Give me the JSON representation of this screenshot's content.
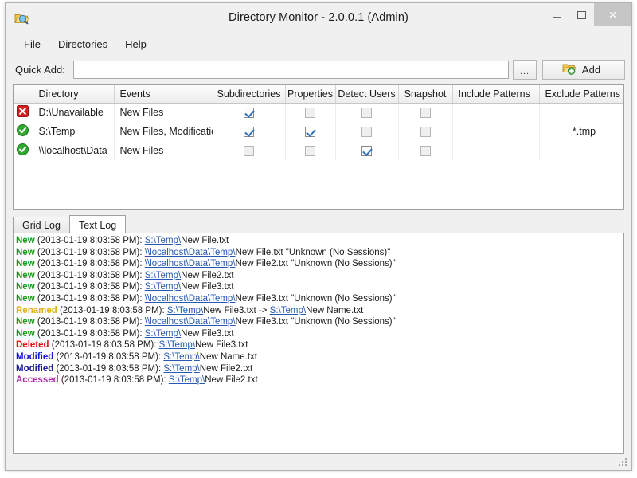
{
  "window": {
    "title": "Directory Monitor - 2.0.0.1 (Admin)",
    "app_icon": "folder-magnifier-icon",
    "minimize_label": "–",
    "maximize_label": "❐",
    "close_label": "×"
  },
  "menu": {
    "items": [
      {
        "label": "File"
      },
      {
        "label": "Directories"
      },
      {
        "label": "Help"
      }
    ]
  },
  "quick_add": {
    "label": "Quick Add:",
    "value": "",
    "placeholder": "",
    "browse_label": "...",
    "add_label": "Add",
    "add_icon": "folder-add-icon"
  },
  "grid": {
    "columns": [
      {
        "key": "status",
        "label": ""
      },
      {
        "key": "directory",
        "label": "Directory"
      },
      {
        "key": "events",
        "label": "Events"
      },
      {
        "key": "subdirectories",
        "label": "Subdirectories"
      },
      {
        "key": "properties",
        "label": "Properties"
      },
      {
        "key": "detect_users",
        "label": "Detect Users"
      },
      {
        "key": "snapshot",
        "label": "Snapshot"
      },
      {
        "key": "include_patterns",
        "label": "Include Patterns"
      },
      {
        "key": "exclude_patterns",
        "label": "Exclude Patterns"
      }
    ],
    "rows": [
      {
        "status": "error-icon",
        "directory": "D:\\Unavailable",
        "events": "New Files",
        "subdirectories": true,
        "properties": false,
        "detect_users": false,
        "snapshot": false,
        "include_patterns": "",
        "exclude_patterns": ""
      },
      {
        "status": "ok-icon",
        "directory": "S:\\Temp",
        "events": "New Files, Modificatio...",
        "subdirectories": true,
        "properties": true,
        "detect_users": false,
        "snapshot": false,
        "include_patterns": "",
        "exclude_patterns": "*.tmp"
      },
      {
        "status": "ok-icon",
        "directory": "\\\\localhost\\Data",
        "events": "New Files",
        "subdirectories": false,
        "properties": false,
        "detect_users": true,
        "snapshot": false,
        "include_patterns": "",
        "exclude_patterns": ""
      }
    ]
  },
  "tabs": [
    {
      "label": "Grid Log",
      "active": false
    },
    {
      "label": "Text Log",
      "active": true
    }
  ],
  "colors": {
    "new": "#1a9a1a",
    "renamed": "#e0b016",
    "deleted": "#e01010",
    "modified": "#1616d8",
    "modified_alt": "#1b1b9a",
    "accessed": "#b028a8",
    "link": "#2759b0"
  },
  "log": {
    "lines": [
      {
        "event": "New",
        "color": "new",
        "timestamp": "(2013-01-19 8:03:58 PM): ",
        "parts": [
          {
            "t": "link",
            "v": "S:\\Temp\\"
          },
          {
            "t": "text",
            "v": "New File.txt"
          }
        ]
      },
      {
        "event": "New",
        "color": "new",
        "timestamp": "(2013-01-19 8:03:58 PM): ",
        "parts": [
          {
            "t": "link",
            "v": "\\\\localhost\\Data\\Temp\\"
          },
          {
            "t": "text",
            "v": "New File.txt \"Unknown (No Sessions)\""
          }
        ]
      },
      {
        "event": "New",
        "color": "new",
        "timestamp": "(2013-01-19 8:03:58 PM): ",
        "parts": [
          {
            "t": "link",
            "v": "\\\\localhost\\Data\\Temp\\"
          },
          {
            "t": "text",
            "v": "New File2.txt \"Unknown (No Sessions)\""
          }
        ]
      },
      {
        "event": "New",
        "color": "new",
        "timestamp": "(2013-01-19 8:03:58 PM): ",
        "parts": [
          {
            "t": "link",
            "v": "S:\\Temp\\"
          },
          {
            "t": "text",
            "v": "New File2.txt"
          }
        ]
      },
      {
        "event": "New",
        "color": "new",
        "timestamp": "(2013-01-19 8:03:58 PM): ",
        "parts": [
          {
            "t": "link",
            "v": "S:\\Temp\\"
          },
          {
            "t": "text",
            "v": "New File3.txt"
          }
        ]
      },
      {
        "event": "New",
        "color": "new",
        "timestamp": "(2013-01-19 8:03:58 PM): ",
        "parts": [
          {
            "t": "link",
            "v": "\\\\localhost\\Data\\Temp\\"
          },
          {
            "t": "text",
            "v": "New File3.txt \"Unknown (No Sessions)\""
          }
        ]
      },
      {
        "event": "Renamed",
        "color": "renamed",
        "timestamp": "(2013-01-19 8:03:58 PM): ",
        "parts": [
          {
            "t": "link",
            "v": "S:\\Temp\\"
          },
          {
            "t": "text",
            "v": "New File3.txt -> "
          },
          {
            "t": "link",
            "v": "S:\\Temp\\"
          },
          {
            "t": "text",
            "v": "New Name.txt"
          }
        ]
      },
      {
        "event": "New",
        "color": "new",
        "timestamp": "(2013-01-19 8:03:58 PM): ",
        "parts": [
          {
            "t": "link",
            "v": "\\\\localhost\\Data\\Temp\\"
          },
          {
            "t": "text",
            "v": "New File3.txt \"Unknown (No Sessions)\""
          }
        ]
      },
      {
        "event": "New",
        "color": "new",
        "timestamp": "(2013-01-19 8:03:58 PM): ",
        "parts": [
          {
            "t": "link",
            "v": "S:\\Temp\\"
          },
          {
            "t": "text",
            "v": "New File3.txt"
          }
        ]
      },
      {
        "event": "Deleted",
        "color": "deleted",
        "timestamp": "(2013-01-19 8:03:58 PM): ",
        "parts": [
          {
            "t": "link",
            "v": "S:\\Temp\\"
          },
          {
            "t": "text",
            "v": "New File3.txt"
          }
        ]
      },
      {
        "event": "Modified",
        "color": "modified",
        "timestamp": "(2013-01-19 8:03:58 PM): ",
        "parts": [
          {
            "t": "link",
            "v": "S:\\Temp\\"
          },
          {
            "t": "text",
            "v": "New Name.txt"
          }
        ]
      },
      {
        "event": "Modified",
        "color": "modified_alt",
        "timestamp": "(2013-01-19 8:03:58 PM): ",
        "parts": [
          {
            "t": "link",
            "v": "S:\\Temp\\"
          },
          {
            "t": "text",
            "v": "New File2.txt"
          }
        ]
      },
      {
        "event": "Accessed",
        "color": "accessed",
        "timestamp": "(2013-01-19 8:03:58 PM): ",
        "parts": [
          {
            "t": "link",
            "v": "S:\\Temp\\"
          },
          {
            "t": "text",
            "v": "New File2.txt"
          }
        ]
      }
    ]
  },
  "statusbar": {
    "grip": "resize-grip-icon"
  }
}
